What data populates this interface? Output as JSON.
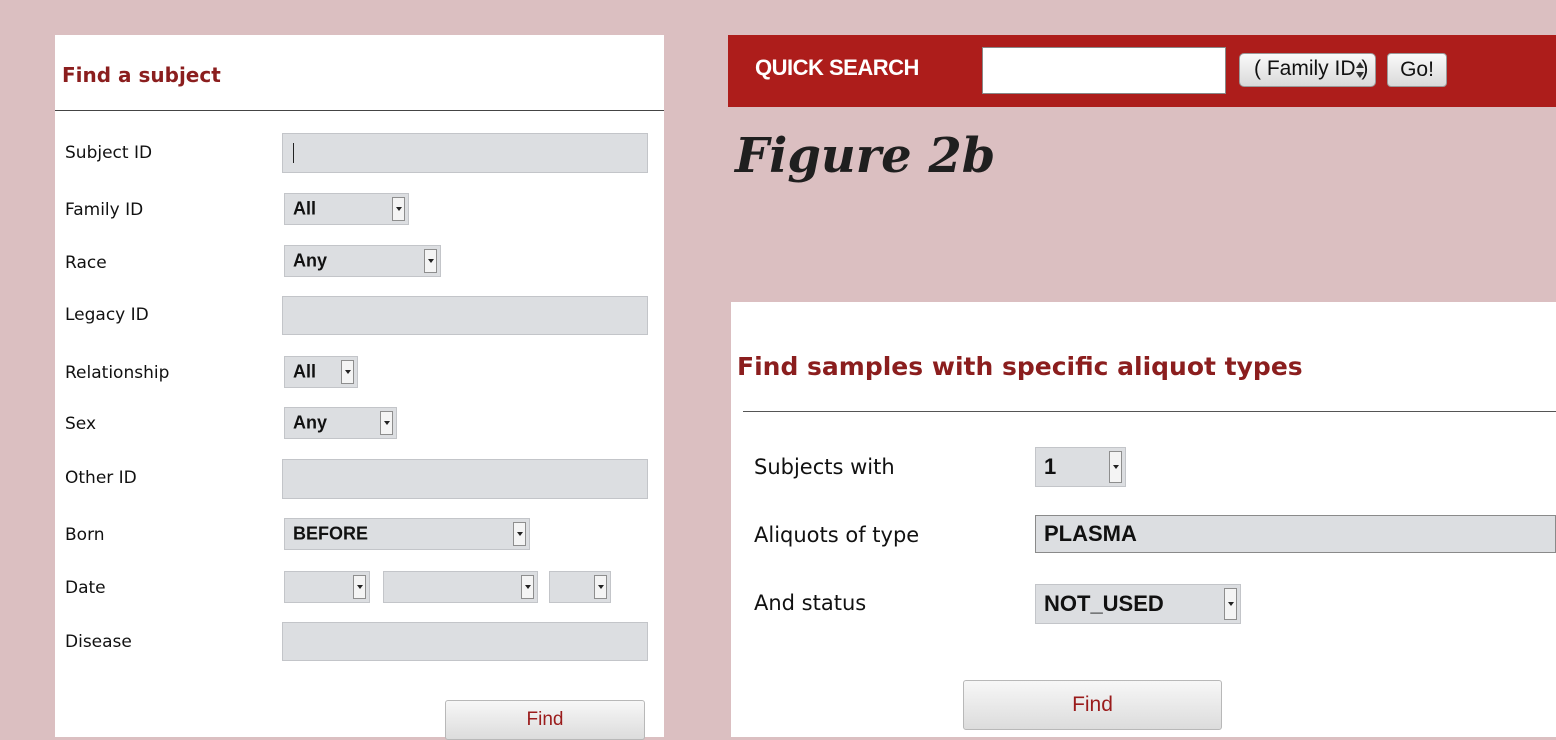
{
  "left_form": {
    "title": "Find a subject",
    "fields": {
      "subject_id": {
        "label": "Subject ID",
        "value": ""
      },
      "family_id": {
        "label": "Family ID",
        "selected": "All"
      },
      "race": {
        "label": "Race",
        "selected": "Any"
      },
      "legacy_id": {
        "label": "Legacy ID",
        "value": ""
      },
      "relationship": {
        "label": "Relationship",
        "selected": "All"
      },
      "sex": {
        "label": "Sex",
        "selected": "Any"
      },
      "other_id": {
        "label": "Other ID",
        "value": ""
      },
      "born": {
        "label": "Born",
        "selected": "BEFORE"
      },
      "date": {
        "label": "Date",
        "month": "",
        "day": "",
        "year": ""
      },
      "disease": {
        "label": "Disease",
        "value": ""
      }
    },
    "find_label": "Find"
  },
  "quick_search": {
    "label": "QUICK SEARCH",
    "value": "",
    "type_selected": "( Family ID )",
    "go_label": "Go!"
  },
  "caption": "Figure 2b",
  "right_form": {
    "title": "Find samples with specific aliquot types",
    "fields": {
      "subjects_with": {
        "label": "Subjects with",
        "selected": "1"
      },
      "aliquot_type": {
        "label": "Aliquots of type",
        "selected": "PLASMA"
      },
      "status": {
        "label": "And status",
        "selected": "NOT_USED"
      }
    },
    "find_label": "Find"
  },
  "colors": {
    "background": "#dbbfc1",
    "title_red": "#8b1e1e",
    "quick_search_bar": "#ad1d1b",
    "field_gray": "#dcdee1"
  },
  "icons": [
    "chevron-down-icon",
    "up-down-arrows-icon"
  ]
}
